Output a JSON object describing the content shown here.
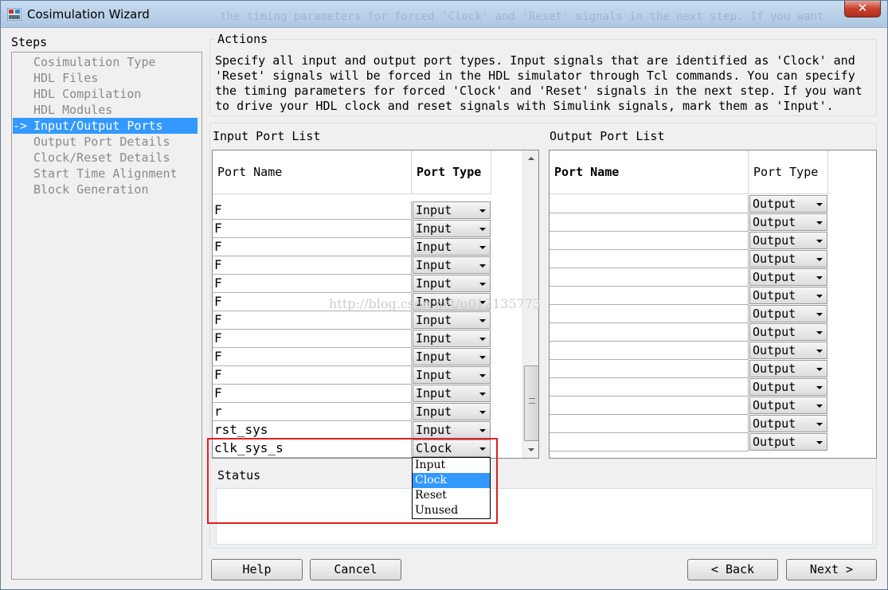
{
  "window": {
    "title": "Cosimulation Wizard",
    "close_glyph": "✕"
  },
  "background_text": "the timing parameters for forced 'Clock' and 'Reset' signals in the next step. If you want",
  "steps": {
    "label": "Steps",
    "items": [
      {
        "label": "Cosimulation Type",
        "active": false
      },
      {
        "label": "HDL Files",
        "active": false
      },
      {
        "label": "HDL Compilation",
        "active": false
      },
      {
        "label": "HDL Modules",
        "active": false
      },
      {
        "label": "Input/Output Ports",
        "active": true
      },
      {
        "label": "Output Port Details",
        "active": false
      },
      {
        "label": "Clock/Reset Details",
        "active": false
      },
      {
        "label": "Start Time Alignment",
        "active": false
      },
      {
        "label": "Block Generation",
        "active": false
      }
    ],
    "active_marker": "->"
  },
  "actions": {
    "title": "Actions",
    "lines": [
      "Specify all input and output port types. Input signals that are identified as 'Clock' and",
      "'Reset' signals will be forced in the HDL simulator through Tcl commands. You can specify",
      "the timing parameters for forced 'Clock' and 'Reset' signals in the next step. If you want",
      "to drive your HDL clock and reset signals with Simulink signals, mark them as 'Input'."
    ]
  },
  "input_list": {
    "title": "Input Port List",
    "col_name": "Port Name",
    "col_type": "Port Type",
    "rows": [
      {
        "name": "F",
        "type": "Input"
      },
      {
        "name": "F",
        "type": "Input"
      },
      {
        "name": "F",
        "type": "Input"
      },
      {
        "name": "F",
        "type": "Input"
      },
      {
        "name": "F",
        "type": "Input"
      },
      {
        "name": "F",
        "type": "Input"
      },
      {
        "name": "F",
        "type": "Input"
      },
      {
        "name": "F",
        "type": "Input"
      },
      {
        "name": "F",
        "type": "Input"
      },
      {
        "name": "F",
        "type": "Input"
      },
      {
        "name": "F",
        "type": "Input"
      },
      {
        "name": "r",
        "type": "Input"
      },
      {
        "name": "rst_sys",
        "type": "Input"
      },
      {
        "name": "clk_sys_s",
        "type": "Clock"
      }
    ],
    "dropdown_options": [
      "Input",
      "Clock",
      "Reset",
      "Unused"
    ],
    "dropdown_selected": "Clock"
  },
  "output_list": {
    "title": "Output Port List",
    "col_name": "Port Name",
    "col_type": "Port Type",
    "rows": [
      "Output",
      "Output",
      "Output",
      "Output",
      "Output",
      "Output",
      "Output",
      "Output",
      "Output",
      "Output",
      "Output",
      "Output",
      "Output",
      "Output"
    ]
  },
  "status": {
    "title": "Status",
    "text": ""
  },
  "buttons": {
    "help": "Help",
    "cancel": "Cancel",
    "back": "< Back",
    "next": "Next >"
  },
  "watermark": "http://blog.csdn.net/u012135773",
  "colors": {
    "selection": "#3399ff",
    "highlight_box": "#e02020"
  }
}
